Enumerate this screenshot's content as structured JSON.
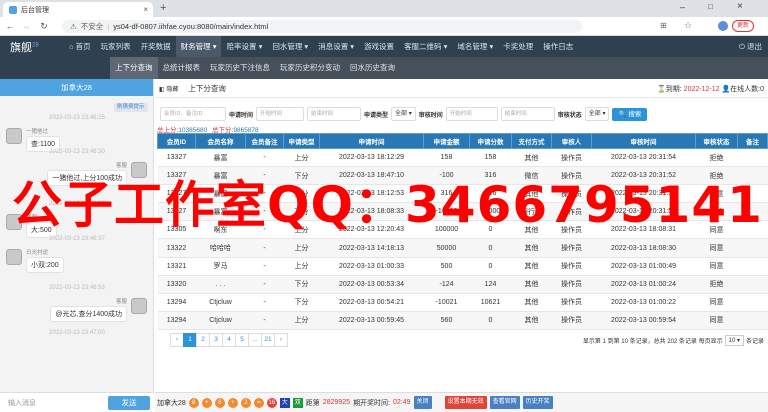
{
  "browser": {
    "tab_title": "后台管理",
    "url_warning": "不安全",
    "url": "ys04-df-0807.iihfae.cyou:8080/main/index.html",
    "update_label": "更新"
  },
  "logo": {
    "text": "旗舰",
    "sup": "28"
  },
  "nav": {
    "items": [
      "首页",
      "玩家列表",
      "开奖数据",
      "财务管理",
      "赔率设置",
      "回水管理",
      "消息设置",
      "游戏设置",
      "客服二维码",
      "域名管理",
      "卡奖处理",
      "操作日志"
    ],
    "exit": "退出"
  },
  "subnav": {
    "items": [
      "上下分查询",
      "总统计报表",
      "玩家历史下注信息",
      "玩家历史积分变动",
      "回水历史查询"
    ]
  },
  "chat": {
    "header": "加拿大28",
    "notice": "刷猜费提示",
    "input_placeholder": "输入消息",
    "send_label": "发送",
    "messages": [
      {
        "time": "2022-03-13 23:46:25",
        "name": "一猪他过",
        "text": "查:1100",
        "side": "left"
      },
      {
        "time": "2022-03-13 23:46:30",
        "name": "客服",
        "text": "一猪他过,上分100成功",
        "side": "right"
      },
      {
        "time": "2022-03-13 23:46:32",
        "name": "嗯嗯",
        "text": "大:500",
        "side": "left"
      },
      {
        "time": "2022-03-13 23:46:37",
        "name": "日光村逆",
        "text": "小双:200",
        "side": "left"
      },
      {
        "time": "2022-03-13 23:46:53",
        "name": "客服",
        "text": "@光芯,查分1400成功",
        "side": "right"
      },
      {
        "time": "2022-03-13 23:47:00",
        "name": "",
        "text": "",
        "side": "left"
      }
    ]
  },
  "page": {
    "title": "上下分查询",
    "hide_label": "隐藏",
    "expire_label": "到期:",
    "expire_date": "2022-12-12",
    "online": "在线人数:0"
  },
  "filters": {
    "placeholder1": "会员ID、备注ID",
    "label_time": "申请时间",
    "placeholder_start": "开始时间",
    "placeholder_end": "结束时间",
    "label_type": "申请类型",
    "type_value": "全部",
    "label_audit_time": "审核时间",
    "label_status": "审核状态",
    "status_value": "全部",
    "search_label": "搜索"
  },
  "totals": {
    "label_up": "总上分:",
    "up": "10385680",
    "label_down": "总下分:",
    "down": "9865878"
  },
  "table": {
    "headers": [
      "会员ID",
      "会员名称",
      "会员备注",
      "申请类型",
      "申请时间",
      "申请金额",
      "申请分数",
      "支付方式",
      "审核人",
      "审核时间",
      "审核状态",
      "备注"
    ],
    "rows": [
      [
        "13327",
        "暴富",
        "-",
        "上分",
        "2022-03-13 18:12:29",
        "158",
        "158",
        "其他",
        "操作员",
        "2022-03-13 20:31:54",
        "拒绝",
        ""
      ],
      [
        "13327",
        "暴富",
        "-",
        "下分",
        "2022-03-13 18:47:10",
        "-100",
        "316",
        "微信",
        "操作员",
        "2022-03-13 20:31:52",
        "拒绝",
        ""
      ],
      [
        "13327",
        "暴富",
        "-",
        "上分",
        "2022-03-13 18:12:53",
        "316",
        "316",
        "其他",
        "操作员",
        "2022-03-13 20:31:58",
        "同意",
        ""
      ],
      [
        "13327",
        "暴富",
        "-",
        "下分",
        "2022-03-13 18:08:33",
        "-10000",
        "10000",
        "银行卡",
        "操作员",
        "2022-03-13 20:31:54",
        "拒绝",
        ""
      ],
      [
        "13305",
        "啊东",
        "-",
        "上分",
        "2022-03-13 12:20:43",
        "100000",
        "0",
        "其他",
        "操作员",
        "2022-03-13 18:08:31",
        "同意",
        ""
      ],
      [
        "13322",
        "哈哈哈",
        "-",
        "上分",
        "2022-03-13 14:18:13",
        "50000",
        "0",
        "其他",
        "操作员",
        "2022-03-13 18:08:30",
        "同意",
        ""
      ],
      [
        "13321",
        "罗马",
        "-",
        "上分",
        "2022-03-13 01:00:33",
        "500",
        "0",
        "其他",
        "操作员",
        "2022-03-13 01:00:49",
        "同意",
        ""
      ],
      [
        "13320",
        ". . .",
        "-",
        "下分",
        "2022-03-13 00:53:34",
        "-124",
        "124",
        "其他",
        "操作员",
        "2022-03-13 01:00:24",
        "拒绝",
        ""
      ],
      [
        "13294",
        "Ctjcluw",
        "-",
        "下分",
        "2022-03-13 00:54:21",
        "-10021",
        "10621",
        "其他",
        "操作员",
        "2022-03-13 01:00:22",
        "同意",
        ""
      ],
      [
        "13294",
        "Ctjcluw",
        "-",
        "上分",
        "2022-03-13 00:59:45",
        "560",
        "0",
        "其他",
        "操作员",
        "2022-03-13 00:59:54",
        "同意",
        ""
      ]
    ]
  },
  "pager": {
    "pages": [
      "‹",
      "1",
      "2",
      "3",
      "4",
      "5",
      "...",
      "21",
      "›"
    ],
    "summary": "显示第 1 到第 10 条记录，总共 202 条记录 每页显示",
    "page_size": "10",
    "per_page_suffix": "条记录"
  },
  "bottom": {
    "game": "加拿大28",
    "b1": "8",
    "op1": "+",
    "b2": "6",
    "op2": "+",
    "b3": "2",
    "eq": "=",
    "sum": "16",
    "size": "大",
    "parity": "双",
    "period_label": "距第",
    "period": "2829925",
    "period_suffix": "期开奖时间:",
    "countdown": "02:49",
    "btn_close": "关闭",
    "btn_set": "设置本期无效",
    "btn_view": "查看官网",
    "btn_history": "历史开奖"
  },
  "watermark": "公子工作室QQ：3466795141"
}
